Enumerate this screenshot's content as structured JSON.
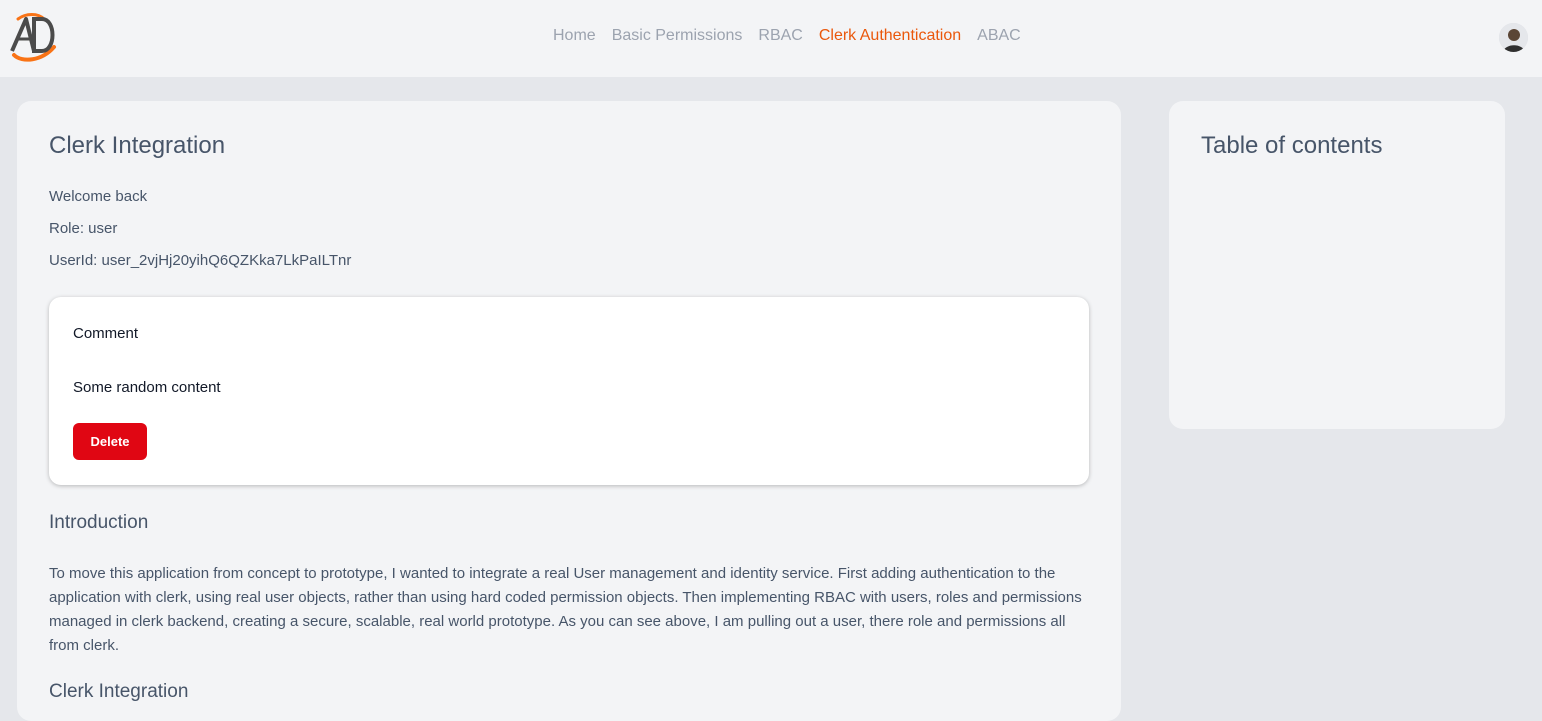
{
  "nav": {
    "items": [
      {
        "label": "Home",
        "active": false
      },
      {
        "label": "Basic Permissions",
        "active": false
      },
      {
        "label": "RBAC",
        "active": false
      },
      {
        "label": "Clerk Authentication",
        "active": true
      },
      {
        "label": "ABAC",
        "active": false
      }
    ]
  },
  "icons": {
    "logo": "ad-logo-icon",
    "avatar": "user-avatar"
  },
  "colors": {
    "accent": "#ea580c",
    "danger": "#e00613",
    "nav_inactive": "#9ca3af",
    "text": "#475569"
  },
  "main": {
    "title": "Clerk Integration",
    "welcome": "Welcome back",
    "role": "Role: user",
    "user_id": "UserId: user_2vjHj20yihQ6QZKka7LkPaILTnr",
    "comment": {
      "title": "Comment",
      "body": "Some random content",
      "delete_label": "Delete"
    },
    "intro_heading": "Introduction",
    "intro_paragraph": "To move this application from concept to prototype, I wanted to integrate a real User management and identity service. First adding authentication to the application with clerk, using real user objects, rather than using hard coded permission objects. Then implementing RBAC with users, roles and permissions managed in clerk backend, creating a secure, scalable, real world prototype. As you can see above, I am pulling out a user, there role and permissions all from clerk.",
    "next_heading": "Clerk Integration"
  },
  "toc": {
    "title": "Table of contents"
  }
}
